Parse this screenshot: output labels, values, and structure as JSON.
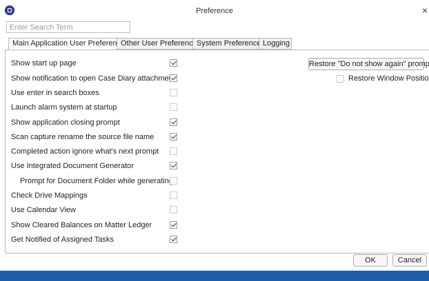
{
  "window": {
    "title": "Preference",
    "close_label": "×"
  },
  "search": {
    "placeholder": "Enter Search Term",
    "value": ""
  },
  "tabs": [
    {
      "label": "Main Application User Preferences",
      "active": true
    },
    {
      "label": "Other User Preferences",
      "active": false
    },
    {
      "label": "System Preferences",
      "active": false
    },
    {
      "label": "Logging",
      "active": false
    }
  ],
  "preferences": [
    {
      "label": "Show start up page",
      "checked": true
    },
    {
      "label": "Show notification to open Case Diary attachment",
      "checked": true
    },
    {
      "label": "Use enter in search boxes",
      "checked": false
    },
    {
      "label": "Launch alarm system at startup",
      "checked": false
    },
    {
      "label": "Show application closing prompt",
      "checked": true
    },
    {
      "label": "Scan capture rename the source file name",
      "checked": true
    },
    {
      "label": "Completed action ignore what's next prompt",
      "checked": false
    },
    {
      "label": "Use Integrated Document Generator",
      "checked": true
    },
    {
      "label": "Prompt for Document Folder while generating",
      "checked": false
    },
    {
      "label": "Check Drive Mappings",
      "checked": false
    },
    {
      "label": "Use Calendar View",
      "checked": false
    },
    {
      "label": "Show Cleared Balances on Matter Ledger",
      "checked": true
    },
    {
      "label": "Get Notified of Assigned Tasks",
      "checked": true
    }
  ],
  "restore_prompts_label": "Restore \"Do not show again\" prompts",
  "restore_window": {
    "label": "Restore Window Positions",
    "checked": false
  },
  "footer": {
    "ok_label": "OK",
    "cancel_label": "Cancel"
  },
  "colors": {
    "statusbar": "#1e5fa8",
    "app_icon": "#3a3f96"
  }
}
